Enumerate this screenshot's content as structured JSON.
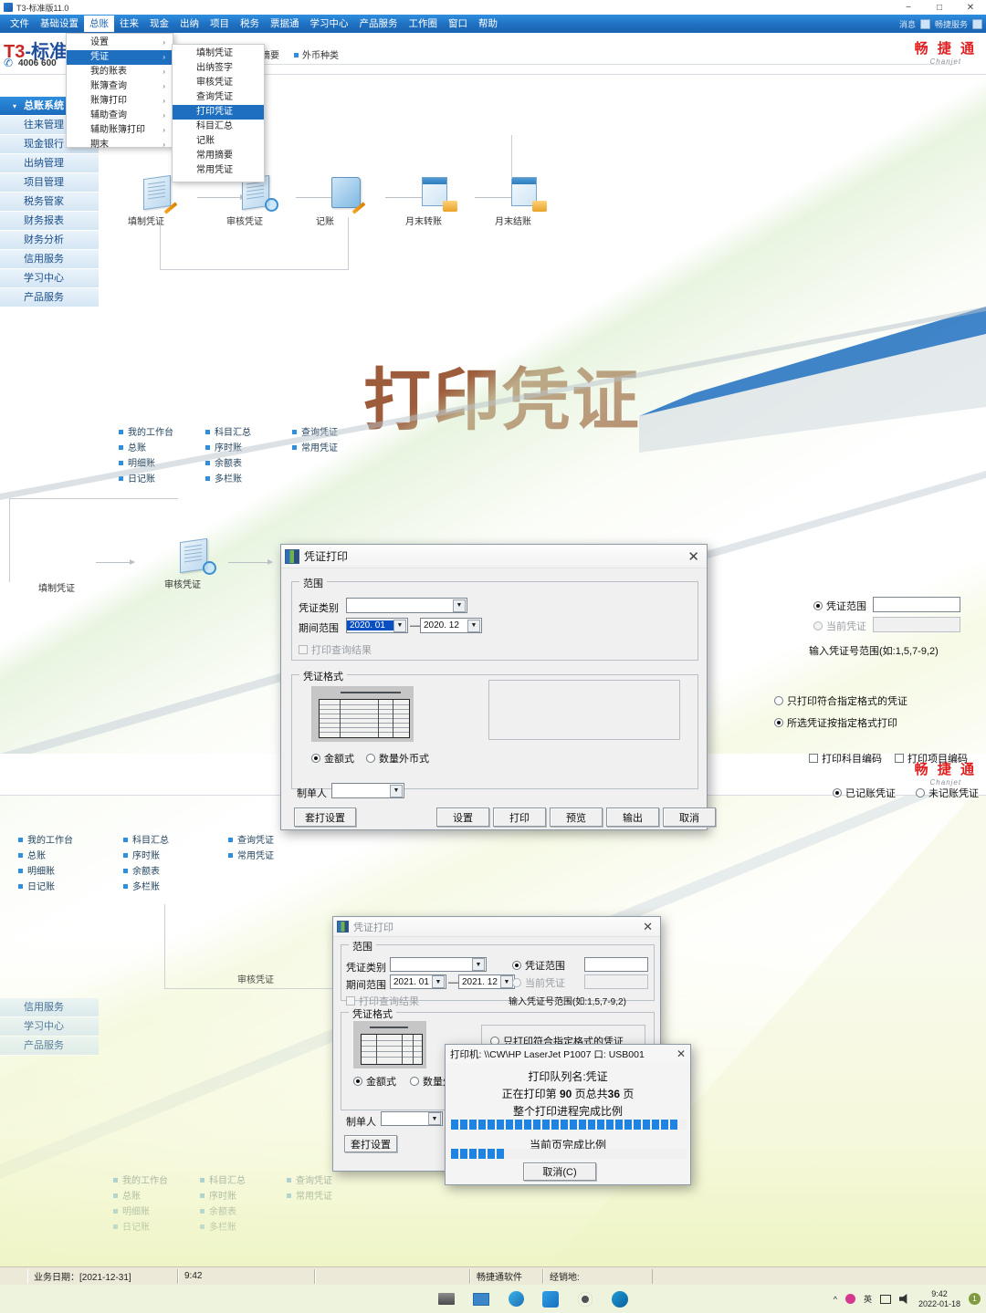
{
  "window": {
    "title": "T3-标准版11.0",
    "minimize": "−",
    "maximize": "□",
    "close": "✕"
  },
  "menubar": {
    "items": [
      {
        "label": "文件",
        "open": false
      },
      {
        "label": "基础设置",
        "open": false
      },
      {
        "label": "总账",
        "open": true
      },
      {
        "label": "往来",
        "open": false
      },
      {
        "label": "现金",
        "open": false
      },
      {
        "label": "出纳",
        "open": false
      },
      {
        "label": "项目",
        "open": false
      },
      {
        "label": "税务",
        "open": false
      },
      {
        "label": "票据通",
        "open": false
      },
      {
        "label": "学习中心",
        "open": false
      },
      {
        "label": "产品服务",
        "open": false
      },
      {
        "label": "工作圈",
        "open": false
      },
      {
        "label": "窗口",
        "open": false
      },
      {
        "label": "帮助",
        "open": false
      }
    ],
    "sys": {
      "message": "消息",
      "service": "畅捷服务"
    }
  },
  "dropdown_l1": {
    "items": [
      {
        "label": "设置",
        "arrow": "›",
        "sel": false
      },
      {
        "label": "凭证",
        "arrow": "›",
        "sel": true
      },
      {
        "label": "我的账表",
        "arrow": "›",
        "sel": false
      },
      {
        "label": "账簿查询",
        "arrow": "›",
        "sel": false
      },
      {
        "label": "账簿打印",
        "arrow": "›",
        "sel": false
      },
      {
        "label": "辅助查询",
        "arrow": "›",
        "sel": false
      },
      {
        "label": "辅助账簿打印",
        "arrow": "›",
        "sel": false
      },
      {
        "label": "期末",
        "arrow": "›",
        "sel": false
      }
    ]
  },
  "dropdown_l2": {
    "items": [
      {
        "label": "填制凭证",
        "sel": false
      },
      {
        "label": "出纳签字",
        "sel": false
      },
      {
        "label": "审核凭证",
        "sel": false
      },
      {
        "label": "查询凭证",
        "sel": false
      },
      {
        "label": "打印凭证",
        "sel": true
      },
      {
        "label": "科目汇总",
        "sel": false
      },
      {
        "label": "记账",
        "sel": false
      },
      {
        "label": "常用摘要",
        "sel": false
      },
      {
        "label": "常用凭证",
        "sel": false
      }
    ]
  },
  "header": {
    "product_t3": "T3",
    "product_dash": "-",
    "product_rest": "标准",
    "phone": "4006 600",
    "brand_cn": "畅 捷 通",
    "brand_en": "Chanjet",
    "zhaiyao": "摘要",
    "waibi": "外币种类"
  },
  "sidebar": {
    "items": [
      {
        "label": "总账系统",
        "selected": true
      },
      {
        "label": "往来管理",
        "selected": false
      },
      {
        "label": "现金银行",
        "selected": false
      },
      {
        "label": "出纳管理",
        "selected": false
      },
      {
        "label": "项目管理",
        "selected": false
      },
      {
        "label": "税务管家",
        "selected": false
      },
      {
        "label": "财务报表",
        "selected": false
      },
      {
        "label": "财务分析",
        "selected": false
      },
      {
        "label": "信用服务",
        "selected": false
      },
      {
        "label": "学习中心",
        "selected": false
      },
      {
        "label": "产品服务",
        "selected": false
      }
    ],
    "bottom_items": [
      {
        "label": "信用服务"
      },
      {
        "label": "学习中心"
      },
      {
        "label": "产品服务"
      }
    ]
  },
  "quicklinks": {
    "col1": [
      "我的工作台",
      "总账",
      "明细账",
      "日记账"
    ],
    "col2": [
      "科目汇总",
      "序时账",
      "余额表",
      "多栏账"
    ],
    "col3": [
      "查询凭证",
      "常用凭证"
    ]
  },
  "workflow": {
    "nodes": [
      "填制凭证",
      "审核凭证",
      "记账",
      "月末转账",
      "月末结账"
    ],
    "nodes_mid": [
      "填制凭证",
      "审核凭证"
    ],
    "nodes_bottom": [
      "审核凭证"
    ]
  },
  "headline": {
    "text": "打印凭证",
    "color": "#9d5c3b"
  },
  "dialog_main": {
    "title": "凭证打印",
    "close": "✕",
    "group_range": "范围",
    "voucher_type_label": "凭证类别",
    "voucher_type_value": "",
    "period_label": "期间范围",
    "period_from": "2020. 01",
    "period_dash": "—",
    "period_to": "2020. 12",
    "print_query_result": "打印查询结果",
    "voucher_range_radio": "凭证范围",
    "voucher_range_value": "",
    "current_voucher_radio": "当前凭证",
    "current_voucher_value": "",
    "hint": "输入凭证号范围(如:1,5,7-9,2)",
    "group_format": "凭证格式",
    "opt_only_matching": "只打印符合指定格式的凭证",
    "opt_selected_by_format": "所选凭证按指定格式打印",
    "fmt_amount": "金额式",
    "fmt_qty_fx": "数量外币式",
    "chk_subject_code": "打印科目编码",
    "chk_project_code": "打印项目编码",
    "maker_label": "制单人",
    "maker_value": "",
    "posted": "已记账凭证",
    "unposted": "未记账凭证",
    "btn_overlay_setup": "套打设置",
    "btn_settings": "设置",
    "btn_print": "打印",
    "btn_preview": "预览",
    "btn_output": "输出",
    "btn_cancel": "取消"
  },
  "dialog_back": {
    "title": "凭证打印",
    "close": "✕",
    "group_range": "范围",
    "voucher_type_label": "凭证类别",
    "period_label": "期间范围",
    "period_from": "2021. 01",
    "period_dash": "—",
    "period_to": "2021. 12",
    "print_query_result": "打印查询结果",
    "voucher_range_radio": "凭证范围",
    "current_voucher_radio": "当前凭证",
    "hint": "输入凭证号范围(如:1,5,7-9,2)",
    "group_format": "凭证格式",
    "opt_only_matching": "只打印符合指定格式的凭证",
    "fmt_amount": "金额式",
    "fmt_qty_fx": "数量外币式",
    "maker_label": "制单人",
    "btn_overlay_setup": "套打设置"
  },
  "print_progress": {
    "printer_line": "打印机: \\\\CW\\HP LaserJet P1007 口: USB001",
    "close": "✕",
    "queue_line": "打印队列名:凭证",
    "page_prefix": "正在打印第",
    "page_current": "90",
    "page_mid": "页总共",
    "page_total": "36",
    "page_suffix": "页",
    "overall_label": "整个打印进程完成比例",
    "overall_blocks": 25,
    "current_label": "当前页完成比例",
    "current_blocks": 6,
    "btn_cancel": "取消(C)"
  },
  "statusbar": {
    "biz_date": "业务日期：[2021-12-31]",
    "time": "9:42",
    "company": "畅捷通软件",
    "dealer": "经销地:"
  },
  "taskbar": {
    "icons": [
      "explorer-icon",
      "taskview-icon",
      "security-icon",
      "chanjet-icon",
      "settings-icon",
      "edge-icon"
    ],
    "tray_chevron": "^",
    "tray_ime": "英",
    "time": "9:42",
    "date": "2022-01-18"
  }
}
